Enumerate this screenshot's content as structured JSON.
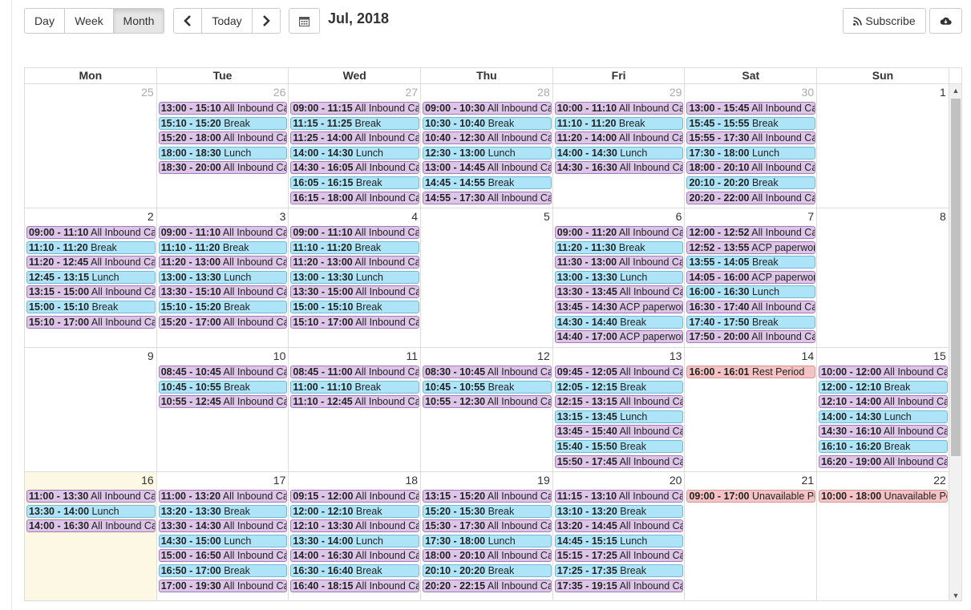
{
  "toolbar": {
    "views": [
      "Day",
      "Week",
      "Month"
    ],
    "active_view": "Month",
    "today_label": "Today",
    "title": "Jul, 2018",
    "subscribe_label": "Subscribe"
  },
  "day_headers": [
    "Mon",
    "Tue",
    "Wed",
    "Thu",
    "Fri",
    "Sat",
    "Sun"
  ],
  "colors": {
    "call": "#ddc5e8",
    "break": "#ade4f7",
    "unavailable": "#f5c3c3",
    "today_bg": "#fcf8e3"
  },
  "weeks": [
    [
      {
        "num": "25",
        "other": true,
        "events": []
      },
      {
        "num": "26",
        "other": true,
        "events": [
          {
            "time": "13:00 - 15:10",
            "title": "All Inbound Ca",
            "kind": "call"
          },
          {
            "time": "15:10 - 15:20",
            "title": "Break",
            "kind": "brk"
          },
          {
            "time": "15:20 - 18:00",
            "title": "All Inbound Ca",
            "kind": "call"
          },
          {
            "time": "18:00 - 18:30",
            "title": "Lunch",
            "kind": "brk"
          },
          {
            "time": "18:30 - 20:00",
            "title": "All Inbound Ca",
            "kind": "call"
          }
        ]
      },
      {
        "num": "27",
        "other": true,
        "events": [
          {
            "time": "09:00 - 11:15",
            "title": "All Inbound Cal",
            "kind": "call"
          },
          {
            "time": "11:15 - 11:25",
            "title": "Break",
            "kind": "brk"
          },
          {
            "time": "11:25 - 14:00",
            "title": "All Inbound Cal",
            "kind": "call"
          },
          {
            "time": "14:00 - 14:30",
            "title": "Lunch",
            "kind": "brk"
          },
          {
            "time": "14:30 - 16:05",
            "title": "All Inbound Ca",
            "kind": "call"
          },
          {
            "time": "16:05 - 16:15",
            "title": "Break",
            "kind": "brk"
          },
          {
            "time": "16:15 - 18:00",
            "title": "All Inbound Ca",
            "kind": "call"
          }
        ]
      },
      {
        "num": "28",
        "other": true,
        "events": [
          {
            "time": "09:00 - 10:30",
            "title": "All Inbound Ca",
            "kind": "call"
          },
          {
            "time": "10:30 - 10:40",
            "title": "Break",
            "kind": "brk"
          },
          {
            "time": "10:40 - 12:30",
            "title": "All Inbound Ca",
            "kind": "call"
          },
          {
            "time": "12:30 - 13:00",
            "title": "Lunch",
            "kind": "brk"
          },
          {
            "time": "13:00 - 14:45",
            "title": "All Inbound Ca",
            "kind": "call"
          },
          {
            "time": "14:45 - 14:55",
            "title": "Break",
            "kind": "brk"
          },
          {
            "time": "14:55 - 17:30",
            "title": "All Inbound Ca",
            "kind": "call"
          }
        ]
      },
      {
        "num": "29",
        "other": true,
        "events": [
          {
            "time": "10:00 - 11:10",
            "title": "All Inbound Cal",
            "kind": "call"
          },
          {
            "time": "11:10 - 11:20",
            "title": "Break",
            "kind": "brk"
          },
          {
            "time": "11:20 - 14:00",
            "title": "All Inbound Ca",
            "kind": "call"
          },
          {
            "time": "14:00 - 14:30",
            "title": "Lunch",
            "kind": "brk"
          },
          {
            "time": "14:30 - 16:30",
            "title": "All Inbound Ca",
            "kind": "call"
          }
        ]
      },
      {
        "num": "30",
        "other": true,
        "events": [
          {
            "time": "13:00 - 15:45",
            "title": "All Inbound Ca",
            "kind": "call"
          },
          {
            "time": "15:45 - 15:55",
            "title": "Break",
            "kind": "brk"
          },
          {
            "time": "15:55 - 17:30",
            "title": "All Inbound Ca",
            "kind": "call"
          },
          {
            "time": "17:30 - 18:00",
            "title": "Lunch",
            "kind": "brk"
          },
          {
            "time": "18:00 - 20:10",
            "title": "All Inbound Ca",
            "kind": "call"
          },
          {
            "time": "20:10 - 20:20",
            "title": "Break",
            "kind": "brk"
          },
          {
            "time": "20:20 - 22:00",
            "title": "All Inbound Ca",
            "kind": "call"
          }
        ]
      },
      {
        "num": "1",
        "other": false,
        "events": []
      }
    ],
    [
      {
        "num": "2",
        "other": false,
        "events": [
          {
            "time": "09:00 - 11:10",
            "title": "All Inbound Ca",
            "kind": "call"
          },
          {
            "time": "11:10 - 11:20",
            "title": "Break",
            "kind": "brk"
          },
          {
            "time": "11:20 - 12:45",
            "title": "All Inbound Ca",
            "kind": "call"
          },
          {
            "time": "12:45 - 13:15",
            "title": "Lunch",
            "kind": "brk"
          },
          {
            "time": "13:15 - 15:00",
            "title": "All Inbound Ca",
            "kind": "call"
          },
          {
            "time": "15:00 - 15:10",
            "title": "Break",
            "kind": "brk"
          },
          {
            "time": "15:10 - 17:00",
            "title": "All Inbound Ca",
            "kind": "call"
          }
        ]
      },
      {
        "num": "3",
        "other": false,
        "events": [
          {
            "time": "09:00 - 11:10",
            "title": "All Inbound Ca",
            "kind": "call"
          },
          {
            "time": "11:10 - 11:20",
            "title": "Break",
            "kind": "brk"
          },
          {
            "time": "11:20 - 13:00",
            "title": "All Inbound Ca",
            "kind": "call"
          },
          {
            "time": "13:00 - 13:30",
            "title": "Lunch",
            "kind": "brk"
          },
          {
            "time": "13:30 - 15:10",
            "title": "All Inbound Ca",
            "kind": "call"
          },
          {
            "time": "15:10 - 15:20",
            "title": "Break",
            "kind": "brk"
          },
          {
            "time": "15:20 - 17:00",
            "title": "All Inbound Ca",
            "kind": "call"
          }
        ]
      },
      {
        "num": "4",
        "other": false,
        "events": [
          {
            "time": "09:00 - 11:10",
            "title": "All Inbound Cal",
            "kind": "call"
          },
          {
            "time": "11:10 - 11:20",
            "title": "Break",
            "kind": "brk"
          },
          {
            "time": "11:20 - 13:00",
            "title": "All Inbound Cal",
            "kind": "call"
          },
          {
            "time": "13:00 - 13:30",
            "title": "Lunch",
            "kind": "brk"
          },
          {
            "time": "13:30 - 15:00",
            "title": "All Inbound Cal",
            "kind": "call"
          },
          {
            "time": "15:00 - 15:10",
            "title": "Break",
            "kind": "brk"
          },
          {
            "time": "15:10 - 17:00",
            "title": "All Inbound Cal",
            "kind": "call"
          }
        ]
      },
      {
        "num": "5",
        "other": false,
        "events": []
      },
      {
        "num": "6",
        "other": false,
        "events": [
          {
            "time": "09:00 - 11:20",
            "title": "All Inbound Cal",
            "kind": "call"
          },
          {
            "time": "11:20 - 11:30",
            "title": "Break",
            "kind": "brk"
          },
          {
            "time": "11:30 - 13:00",
            "title": "All Inbound Cal",
            "kind": "call"
          },
          {
            "time": "13:00 - 13:30",
            "title": "Lunch",
            "kind": "brk"
          },
          {
            "time": "13:30 - 13:45",
            "title": "All Inbound Cal",
            "kind": "call"
          },
          {
            "time": "13:45 - 14:30",
            "title": "ACP paperworl",
            "kind": "call"
          },
          {
            "time": "14:30 - 14:40",
            "title": "Break",
            "kind": "brk"
          },
          {
            "time": "14:40 - 17:00",
            "title": "ACP paperworl",
            "kind": "call"
          }
        ]
      },
      {
        "num": "7",
        "other": false,
        "events": [
          {
            "time": "12:00 - 12:52",
            "title": "All Inbound Ca",
            "kind": "call"
          },
          {
            "time": "12:52 - 13:55",
            "title": "ACP paperwor",
            "kind": "call"
          },
          {
            "time": "13:55 - 14:05",
            "title": "Break",
            "kind": "brk"
          },
          {
            "time": "14:05 - 16:00",
            "title": "ACP paperwor",
            "kind": "call"
          },
          {
            "time": "16:00 - 16:30",
            "title": "Lunch",
            "kind": "brk"
          },
          {
            "time": "16:30 - 17:40",
            "title": "All Inbound Ca",
            "kind": "call"
          },
          {
            "time": "17:40 - 17:50",
            "title": "Break",
            "kind": "brk"
          },
          {
            "time": "17:50 - 20:00",
            "title": "All Inbound Ca",
            "kind": "call"
          }
        ]
      },
      {
        "num": "8",
        "other": false,
        "events": []
      }
    ],
    [
      {
        "num": "9",
        "other": false,
        "events": []
      },
      {
        "num": "10",
        "other": false,
        "events": [
          {
            "time": "08:45 - 10:45",
            "title": "All Inbound Ca",
            "kind": "call"
          },
          {
            "time": "10:45 - 10:55",
            "title": "Break",
            "kind": "brk"
          },
          {
            "time": "10:55 - 12:45",
            "title": "All Inbound Ca",
            "kind": "call"
          }
        ]
      },
      {
        "num": "11",
        "other": false,
        "events": [
          {
            "time": "08:45 - 11:00",
            "title": "All Inbound Cal",
            "kind": "call"
          },
          {
            "time": "11:00 - 11:10",
            "title": "Break",
            "kind": "brk"
          },
          {
            "time": "11:10 - 12:45",
            "title": "All Inbound Cal",
            "kind": "call"
          }
        ]
      },
      {
        "num": "12",
        "other": false,
        "events": [
          {
            "time": "08:30 - 10:45",
            "title": "All Inbound Ca",
            "kind": "call"
          },
          {
            "time": "10:45 - 10:55",
            "title": "Break",
            "kind": "brk"
          },
          {
            "time": "10:55 - 12:30",
            "title": "All Inbound Ca",
            "kind": "call"
          }
        ]
      },
      {
        "num": "13",
        "other": false,
        "events": [
          {
            "time": "09:45 - 12:05",
            "title": "All Inbound Ca",
            "kind": "call"
          },
          {
            "time": "12:05 - 12:15",
            "title": "Break",
            "kind": "brk"
          },
          {
            "time": "12:15 - 13:15",
            "title": "All Inbound Ca",
            "kind": "call"
          },
          {
            "time": "13:15 - 13:45",
            "title": "Lunch",
            "kind": "brk"
          },
          {
            "time": "13:45 - 15:40",
            "title": "All Inbound Ca",
            "kind": "call"
          },
          {
            "time": "15:40 - 15:50",
            "title": "Break",
            "kind": "brk"
          },
          {
            "time": "15:50 - 17:45",
            "title": "All Inbound Ca",
            "kind": "call"
          }
        ]
      },
      {
        "num": "14",
        "other": false,
        "events": [
          {
            "time": "16:00 - 16:01",
            "title": "Rest Period",
            "kind": "unav"
          }
        ]
      },
      {
        "num": "15",
        "other": false,
        "events": [
          {
            "time": "10:00 - 12:00",
            "title": "All Inbound Ca",
            "kind": "call"
          },
          {
            "time": "12:00 - 12:10",
            "title": "Break",
            "kind": "brk"
          },
          {
            "time": "12:10 - 14:00",
            "title": "All Inbound Ca",
            "kind": "call"
          },
          {
            "time": "14:00 - 14:30",
            "title": "Lunch",
            "kind": "brk"
          },
          {
            "time": "14:30 - 16:10",
            "title": "All Inbound Ca",
            "kind": "call"
          },
          {
            "time": "16:10 - 16:20",
            "title": "Break",
            "kind": "brk"
          },
          {
            "time": "16:20 - 19:00",
            "title": "All Inbound Ca",
            "kind": "call"
          }
        ]
      }
    ],
    [
      {
        "num": "16",
        "other": false,
        "today": true,
        "events": [
          {
            "time": "11:00 - 13:30",
            "title": "All Inbound Ca",
            "kind": "call"
          },
          {
            "time": "13:30 - 14:00",
            "title": "Lunch",
            "kind": "brk"
          },
          {
            "time": "14:00 - 16:30",
            "title": "All Inbound Ca",
            "kind": "call"
          }
        ]
      },
      {
        "num": "17",
        "other": false,
        "events": [
          {
            "time": "11:00 - 13:20",
            "title": "All Inbound Ca",
            "kind": "call"
          },
          {
            "time": "13:20 - 13:30",
            "title": "Break",
            "kind": "brk"
          },
          {
            "time": "13:30 - 14:30",
            "title": "All Inbound Ca",
            "kind": "call"
          },
          {
            "time": "14:30 - 15:00",
            "title": "Lunch",
            "kind": "brk"
          },
          {
            "time": "15:00 - 16:50",
            "title": "All Inbound Ca",
            "kind": "call"
          },
          {
            "time": "16:50 - 17:00",
            "title": "Break",
            "kind": "brk"
          },
          {
            "time": "17:00 - 19:30",
            "title": "All Inbound Ca",
            "kind": "call"
          }
        ]
      },
      {
        "num": "18",
        "other": false,
        "events": [
          {
            "time": "09:15 - 12:00",
            "title": "All Inbound Ca",
            "kind": "call"
          },
          {
            "time": "12:00 - 12:10",
            "title": "Break",
            "kind": "brk"
          },
          {
            "time": "12:10 - 13:30",
            "title": "All Inbound Ca",
            "kind": "call"
          },
          {
            "time": "13:30 - 14:00",
            "title": "Lunch",
            "kind": "brk"
          },
          {
            "time": "14:00 - 16:30",
            "title": "All Inbound Ca",
            "kind": "call"
          },
          {
            "time": "16:30 - 16:40",
            "title": "Break",
            "kind": "brk"
          },
          {
            "time": "16:40 - 18:15",
            "title": "All Inbound Ca",
            "kind": "call"
          }
        ]
      },
      {
        "num": "19",
        "other": false,
        "events": [
          {
            "time": "13:15 - 15:20",
            "title": "All Inbound Ca",
            "kind": "call"
          },
          {
            "time": "15:20 - 15:30",
            "title": "Break",
            "kind": "brk"
          },
          {
            "time": "15:30 - 17:30",
            "title": "All Inbound Ca",
            "kind": "call"
          },
          {
            "time": "17:30 - 18:00",
            "title": "Lunch",
            "kind": "brk"
          },
          {
            "time": "18:00 - 20:10",
            "title": "All Inbound Ca",
            "kind": "call"
          },
          {
            "time": "20:10 - 20:20",
            "title": "Break",
            "kind": "brk"
          },
          {
            "time": "20:20 - 22:15",
            "title": "All Inbound Ca",
            "kind": "call"
          }
        ]
      },
      {
        "num": "20",
        "other": false,
        "events": [
          {
            "time": "11:15 - 13:10",
            "title": "All Inbound Cal",
            "kind": "call"
          },
          {
            "time": "13:10 - 13:20",
            "title": "Break",
            "kind": "brk"
          },
          {
            "time": "13:20 - 14:45",
            "title": "All Inbound Ca",
            "kind": "call"
          },
          {
            "time": "14:45 - 15:15",
            "title": "Lunch",
            "kind": "brk"
          },
          {
            "time": "15:15 - 17:25",
            "title": "All Inbound Ca",
            "kind": "call"
          },
          {
            "time": "17:25 - 17:35",
            "title": "Break",
            "kind": "brk"
          },
          {
            "time": "17:35 - 19:15",
            "title": "All Inbound Ca",
            "kind": "call"
          }
        ]
      },
      {
        "num": "21",
        "other": false,
        "events": [
          {
            "time": "09:00 - 17:00",
            "title": "Unavailable Pe",
            "kind": "unav"
          }
        ]
      },
      {
        "num": "22",
        "other": false,
        "events": [
          {
            "time": "10:00 - 18:00",
            "title": "Unavailable Pe",
            "kind": "unav"
          }
        ]
      }
    ]
  ]
}
